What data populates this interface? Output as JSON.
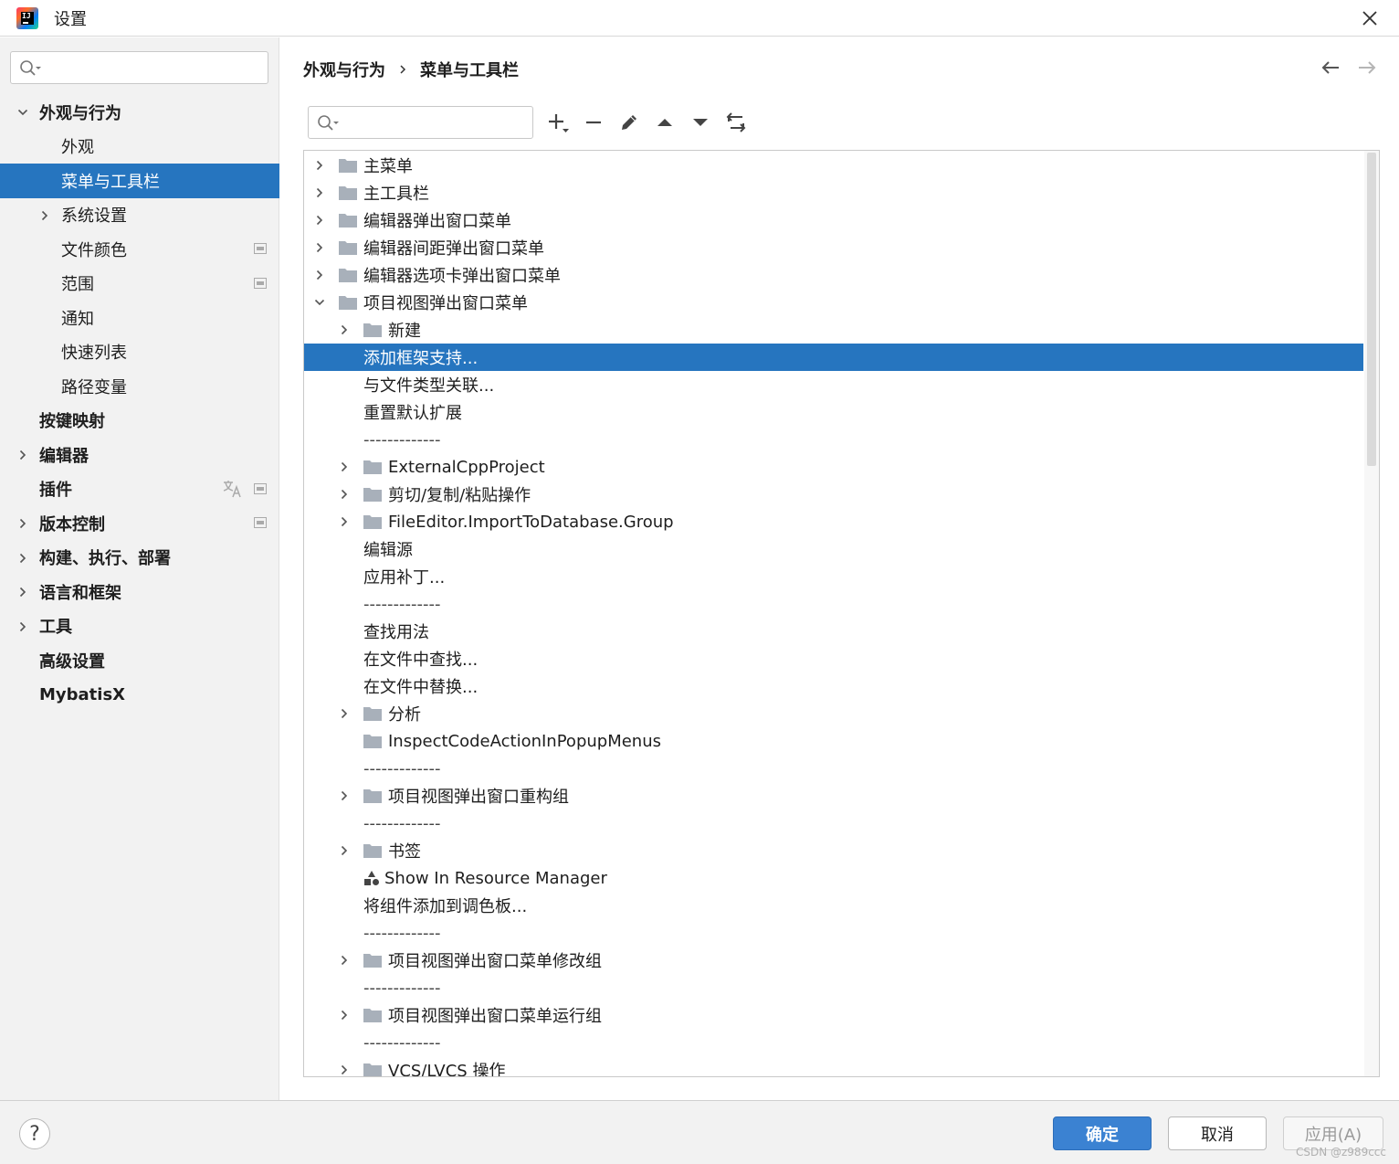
{
  "window": {
    "title": "设置"
  },
  "sidebar": {
    "search_placeholder": "",
    "items": [
      {
        "label": "外观与行为",
        "level": 0,
        "bold": true,
        "expandable": true,
        "expanded": true
      },
      {
        "label": "外观",
        "level": 1,
        "bold": false,
        "expandable": false
      },
      {
        "label": "菜单与工具栏",
        "level": 1,
        "bold": false,
        "expandable": false,
        "selected": true
      },
      {
        "label": "系统设置",
        "level": 1,
        "bold": false,
        "expandable": true,
        "expanded": false
      },
      {
        "label": "文件颜色",
        "level": 1,
        "bold": false,
        "expandable": false,
        "project_marker": true
      },
      {
        "label": "范围",
        "level": 1,
        "bold": false,
        "expandable": false,
        "project_marker": true
      },
      {
        "label": "通知",
        "level": 1,
        "bold": false,
        "expandable": false
      },
      {
        "label": "快速列表",
        "level": 1,
        "bold": false,
        "expandable": false
      },
      {
        "label": "路径变量",
        "level": 1,
        "bold": false,
        "expandable": false
      },
      {
        "label": "按键映射",
        "level": 0,
        "bold": true,
        "expandable": false
      },
      {
        "label": "编辑器",
        "level": 0,
        "bold": true,
        "expandable": true,
        "expanded": false
      },
      {
        "label": "插件",
        "level": 0,
        "bold": true,
        "expandable": false,
        "project_marker": true,
        "translate_icon": true
      },
      {
        "label": "版本控制",
        "level": 0,
        "bold": true,
        "expandable": true,
        "expanded": false,
        "project_marker": true
      },
      {
        "label": "构建、执行、部署",
        "level": 0,
        "bold": true,
        "expandable": true,
        "expanded": false
      },
      {
        "label": "语言和框架",
        "level": 0,
        "bold": true,
        "expandable": true,
        "expanded": false
      },
      {
        "label": "工具",
        "level": 0,
        "bold": true,
        "expandable": true,
        "expanded": false
      },
      {
        "label": "高级设置",
        "level": 0,
        "bold": true,
        "expandable": false
      },
      {
        "label": "MybatisX",
        "level": 0,
        "bold": true,
        "expandable": false
      }
    ]
  },
  "breadcrumb": [
    "外观与行为",
    "菜单与工具栏"
  ],
  "toolbar": {
    "search_placeholder": "",
    "buttons": [
      "add-icon",
      "remove-icon",
      "edit-icon",
      "move-up-icon",
      "move-down-icon",
      "restore-icon"
    ]
  },
  "tree": [
    {
      "label": "主菜单",
      "level": 0,
      "type": "folder",
      "arrow": "right"
    },
    {
      "label": "主工具栏",
      "level": 0,
      "type": "folder",
      "arrow": "right"
    },
    {
      "label": "编辑器弹出窗口菜单",
      "level": 0,
      "type": "folder",
      "arrow": "right"
    },
    {
      "label": "编辑器间距弹出窗口菜单",
      "level": 0,
      "type": "folder",
      "arrow": "right"
    },
    {
      "label": "编辑器选项卡弹出窗口菜单",
      "level": 0,
      "type": "folder",
      "arrow": "right"
    },
    {
      "label": "项目视图弹出窗口菜单",
      "level": 0,
      "type": "folder",
      "arrow": "down"
    },
    {
      "label": "新建",
      "level": 1,
      "type": "folder",
      "arrow": "right"
    },
    {
      "label": "添加框架支持...",
      "level": 1,
      "type": "action",
      "selected": true
    },
    {
      "label": "与文件类型关联...",
      "level": 1,
      "type": "action"
    },
    {
      "label": "重置默认扩展",
      "level": 1,
      "type": "action"
    },
    {
      "label": "-------------",
      "level": 1,
      "type": "separator"
    },
    {
      "label": "ExternalCppProject",
      "level": 1,
      "type": "folder",
      "arrow": "right"
    },
    {
      "label": "剪切/复制/粘贴操作",
      "level": 1,
      "type": "folder",
      "arrow": "right"
    },
    {
      "label": "FileEditor.ImportToDatabase.Group",
      "level": 1,
      "type": "folder",
      "arrow": "right"
    },
    {
      "label": "编辑源",
      "level": 1,
      "type": "action"
    },
    {
      "label": "应用补丁...",
      "level": 1,
      "type": "action"
    },
    {
      "label": "-------------",
      "level": 1,
      "type": "separator"
    },
    {
      "label": "查找用法",
      "level": 1,
      "type": "action"
    },
    {
      "label": "在文件中查找...",
      "level": 1,
      "type": "action"
    },
    {
      "label": "在文件中替换...",
      "level": 1,
      "type": "action"
    },
    {
      "label": "分析",
      "level": 1,
      "type": "folder",
      "arrow": "right"
    },
    {
      "label": "InspectCodeActionInPopupMenus",
      "level": 1,
      "type": "folder"
    },
    {
      "label": "-------------",
      "level": 1,
      "type": "separator"
    },
    {
      "label": "项目视图弹出窗口重构组",
      "level": 1,
      "type": "folder",
      "arrow": "right"
    },
    {
      "label": "-------------",
      "level": 1,
      "type": "separator"
    },
    {
      "label": "书签",
      "level": 1,
      "type": "folder",
      "arrow": "right"
    },
    {
      "label": "Show In Resource Manager",
      "level": 1,
      "type": "resource"
    },
    {
      "label": "将组件添加到调色板...",
      "level": 1,
      "type": "action"
    },
    {
      "label": "-------------",
      "level": 1,
      "type": "separator"
    },
    {
      "label": "项目视图弹出窗口菜单修改组",
      "level": 1,
      "type": "folder",
      "arrow": "right"
    },
    {
      "label": "-------------",
      "level": 1,
      "type": "separator"
    },
    {
      "label": "项目视图弹出窗口菜单运行组",
      "level": 1,
      "type": "folder",
      "arrow": "right"
    },
    {
      "label": "-------------",
      "level": 1,
      "type": "separator"
    },
    {
      "label": "VCS/LVCS 操作",
      "level": 1,
      "type": "folder",
      "arrow": "right"
    }
  ],
  "footer": {
    "help_label": "?",
    "ok_label": "确定",
    "cancel_label": "取消",
    "apply_label": "应用(A)",
    "watermark": "CSDN @z989ccc"
  },
  "colors": {
    "selection": "#2675bf",
    "sidebar_bg": "#f2f2f2",
    "folder": "#a8b0ba",
    "ok_button": "#3b82d2"
  }
}
